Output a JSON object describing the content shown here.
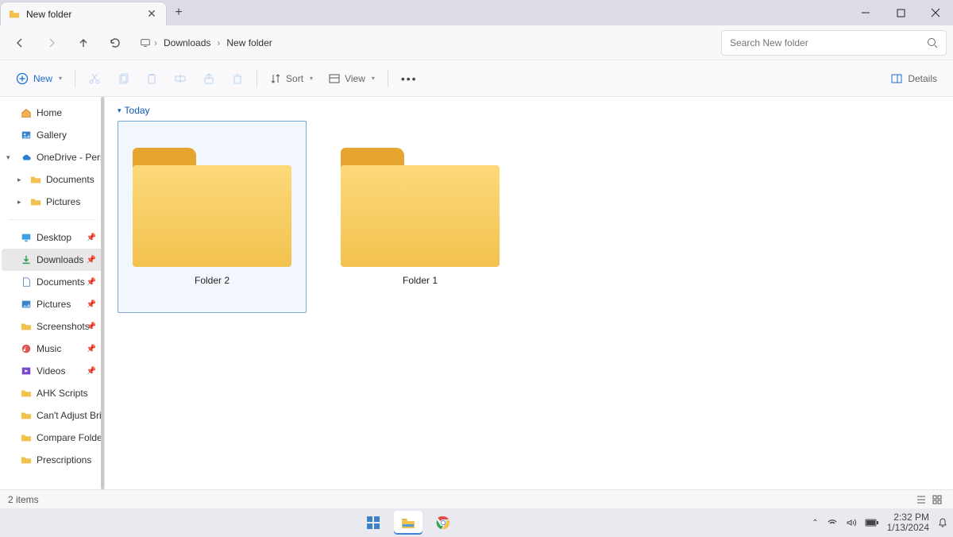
{
  "tab": {
    "title": "New folder"
  },
  "breadcrumb": {
    "seg1": "Downloads",
    "seg2": "New folder"
  },
  "search": {
    "placeholder": "Search New folder"
  },
  "toolbar": {
    "new": "New",
    "sort": "Sort",
    "view": "View",
    "details": "Details"
  },
  "sidebar": {
    "home": "Home",
    "gallery": "Gallery",
    "onedrive": "OneDrive - Perso",
    "od_documents": "Documents",
    "od_pictures": "Pictures",
    "desktop": "Desktop",
    "downloads": "Downloads",
    "documents": "Documents",
    "pictures": "Pictures",
    "screenshots": "Screenshots",
    "music": "Music",
    "videos": "Videos",
    "ahk": "AHK Scripts",
    "cant": "Can't Adjust Bri",
    "compare": "Compare Folder",
    "prescriptions": "Prescriptions"
  },
  "group": {
    "today": "Today"
  },
  "items": {
    "folder2": "Folder 2",
    "folder1": "Folder 1"
  },
  "status": {
    "count": "2 items"
  },
  "clock": {
    "time": "2:32 PM",
    "date": "1/13/2024"
  }
}
